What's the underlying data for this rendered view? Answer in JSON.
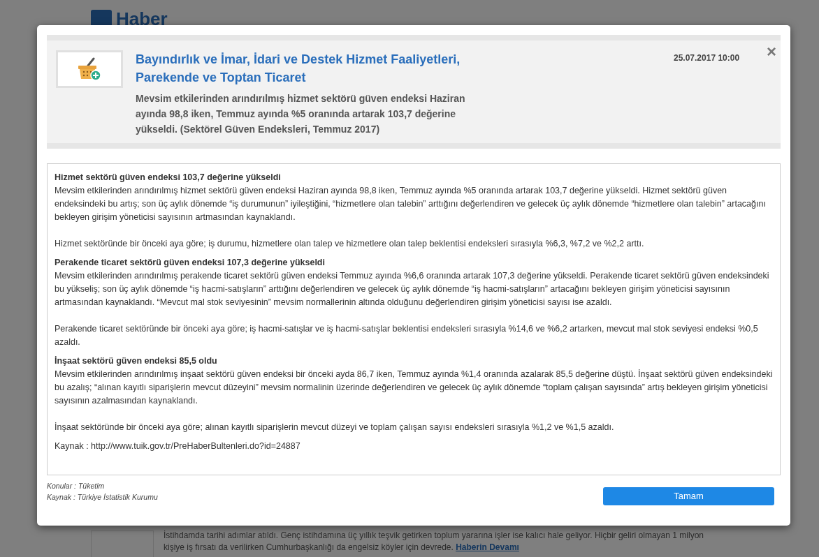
{
  "background_page": {
    "logo": "Haber",
    "article": {
      "summary": "İstihdamda tarihi adımlar atıldı. Genç istihdamına üç yıllık teşvik getirken toplum yararına işler ise kalıcı hale geliyor. Hiçbir geliri olmayan 1 milyon kişiye iş fırsatı da verilirken Cumhurbaşkanlığı da engelsiz köyler için devrede.",
      "link": "Haberin Devamı"
    }
  },
  "modal": {
    "title": "Bayındırlık ve İmar, İdari ve Destek Hizmet Faaliyetleri, Parekende ve Toptan Ticaret",
    "summary": "Mevsim etkilerinden arındırılmış hizmet sektörü güven endeksi Haziran ayında 98,8 iken, Temmuz ayında %5 oranında artarak 103,7 değerine yükseldi. (Sektörel Güven Endeksleri, Temmuz 2017)",
    "date": "25.07.2017 10:00",
    "close": "×",
    "body": [
      {
        "kind": "heading",
        "text": "Hizmet sektörü güven endeksi 103,7 değerine yükseldi"
      },
      {
        "kind": "paragraph",
        "text": "Mevsim etkilerinden arındırılmış hizmet sektörü güven endeksi Haziran ayında 98,8 iken, Temmuz ayında %5 oranında artarak 103,7 değerine yükseldi. Hizmet sektörü güven endeksindeki bu artış; son üç aylık dönemde “iş durumunun” iyileştiğini, “hizmetlere olan talebin” arttığını değerlendiren ve gelecek üç aylık dönemde “hizmetlere olan talebin” artacağını bekleyen girişim yöneticisi sayısının artmasından kaynaklandı."
      },
      {
        "kind": "paragraph",
        "text": "Hizmet sektöründe bir önceki aya göre; iş durumu, hizmetlere olan talep ve hizmetlere olan talep beklentisi endeksleri sırasıyla %6,3, %7,2 ve %2,2 arttı."
      },
      {
        "kind": "heading",
        "text": "Perakende ticaret sektörü güven endeksi 107,3 değerine yükseldi"
      },
      {
        "kind": "paragraph",
        "text": "Mevsim etkilerinden arındırılmış perakende ticaret sektörü güven endeksi Temmuz ayında %6,6 oranında artarak 107,3 değerine yükseldi. Perakende ticaret sektörü güven endeksindeki bu yükseliş; son üç aylık dönemde “iş hacmi-satışların” arttığını değerlendiren ve gelecek üç aylık dönemde “iş hacmi-satışların” artacağını bekleyen girişim yöneticisi sayısının artmasından kaynaklandı. “Mevcut mal stok seviyesinin” mevsim normallerinin altında olduğunu değerlendiren girişim yöneticisi sayısı ise azaldı."
      },
      {
        "kind": "paragraph",
        "text": "Perakende ticaret sektöründe bir önceki aya göre; iş hacmi-satışlar ve iş hacmi-satışlar beklentisi endeksleri sırasıyla %14,6 ve %6,2 artarken, mevcut mal stok seviyesi endeksi %0,5 azaldı."
      },
      {
        "kind": "heading",
        "text": "İnşaat sektörü güven endeksi 85,5 oldu"
      },
      {
        "kind": "paragraph",
        "text": "Mevsim etkilerinden arındırılmış inşaat sektörü güven endeksi bir önceki ayda 86,7 iken, Temmuz ayında %1,4 oranında azalarak 85,5 değerine düştü. İnşaat sektörü güven endeksindeki bu azalış; “alınan kayıtlı siparişlerin mevcut düzeyini” mevsim normalinin üzerinde değerlendiren ve gelecek üç aylık dönemde “toplam çalışan sayısında” artış bekleyen girişim yöneticisi sayısının azalmasından kaynaklandı."
      },
      {
        "kind": "paragraph",
        "text": "İnşaat sektöründe bir önceki aya göre; alınan kayıtlı siparişlerin mevcut düzeyi ve toplam çalışan sayısı endeksleri sırasıyla %1,2 ve %1,5 azaldı."
      },
      {
        "kind": "source",
        "text": "Kaynak : http://www.tuik.gov.tr/PreHaberBultenleri.do?id=24887"
      }
    ],
    "footer_notes": [
      "Konular : Tüketim",
      "Kaynak : Türkiye İstatistik Kurumu"
    ],
    "ok_button": "Tamam"
  }
}
